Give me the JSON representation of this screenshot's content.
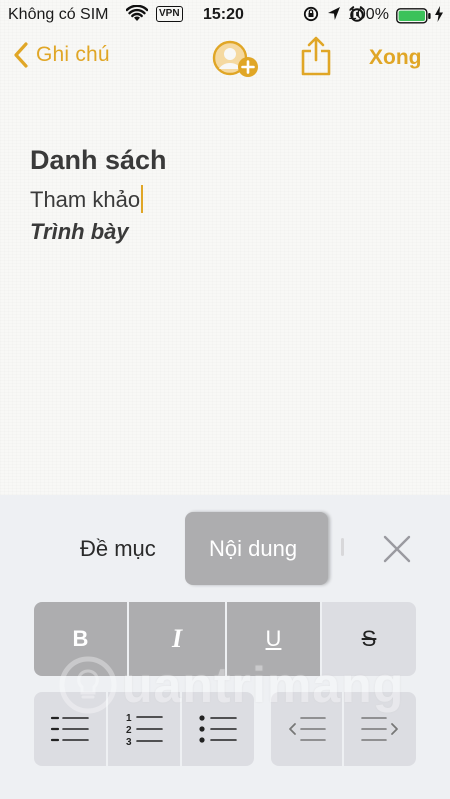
{
  "status_bar": {
    "carrier": "Không có SIM",
    "vpn": "VPN",
    "time": "15:20",
    "battery_percent": "100%",
    "battery_level": 1.0
  },
  "nav": {
    "back_label": "Ghi chú",
    "done_label": "Xong"
  },
  "note": {
    "title": "Danh sách",
    "body": "Tham khảo",
    "italic": "Trình bày"
  },
  "format_panel": {
    "styles": [
      "Đề mục",
      "Nội dung"
    ],
    "selected_style": "Nội dung",
    "text_styles": [
      "B",
      "I",
      "U",
      "S"
    ],
    "active_text_styles": [
      "B",
      "I",
      "U"
    ]
  },
  "watermark": {
    "text": "uantrimang"
  },
  "colors": {
    "accent": "#e0a626",
    "segment_active": "#adadaf",
    "segment_inactive": "#dcdde2",
    "panel_bg": "#eef0f3"
  }
}
